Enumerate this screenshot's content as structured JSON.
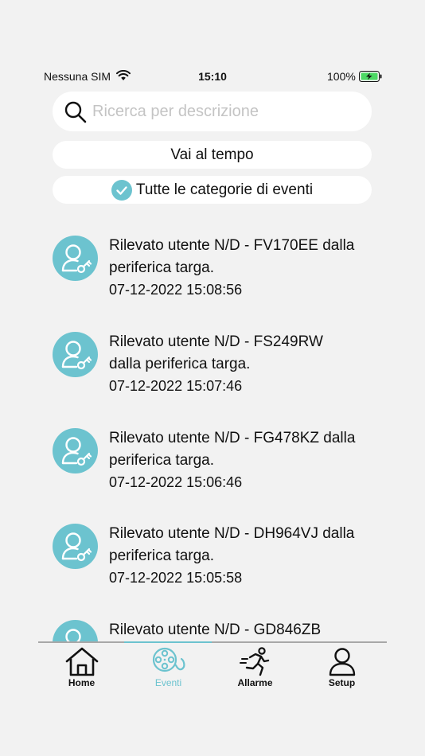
{
  "status_bar": {
    "carrier": "Nessuna SIM",
    "time": "15:10",
    "battery": "100%"
  },
  "search": {
    "placeholder": "Ricerca per descrizione",
    "value": ""
  },
  "goto_time_label": "Vai al tempo",
  "categories_label": "Tutte le categorie di eventi",
  "events": [
    {
      "lines": [
        "Rilevato utente N/D - FV170EE dalla",
        "periferica targa."
      ],
      "time": "07-12-2022 15:08:56"
    },
    {
      "lines": [
        "Rilevato utente N/D - FS249RW",
        "dalla periferica targa."
      ],
      "time": "07-12-2022 15:07:46"
    },
    {
      "lines": [
        "Rilevato utente N/D - FG478KZ dalla",
        "periferica targa."
      ],
      "time": "07-12-2022 15:06:46"
    },
    {
      "lines": [
        "Rilevato utente N/D - DH964VJ dalla",
        "periferica targa."
      ],
      "time": "07-12-2022 15:05:58"
    },
    {
      "lines": [
        "Rilevato utente N/D - GD846ZB",
        ""
      ],
      "time": ""
    }
  ],
  "tabs": [
    {
      "label": "Home",
      "icon": "home-icon",
      "active": false
    },
    {
      "label": "Eventi",
      "icon": "film-reel-icon",
      "active": true
    },
    {
      "label": "Allarme",
      "icon": "running-person-icon",
      "active": false
    },
    {
      "label": "Setup",
      "icon": "user-icon",
      "active": false
    }
  ],
  "colors": {
    "accent": "#6cc3cf",
    "background": "#f2f2f2",
    "battery_green": "#4cd964"
  }
}
